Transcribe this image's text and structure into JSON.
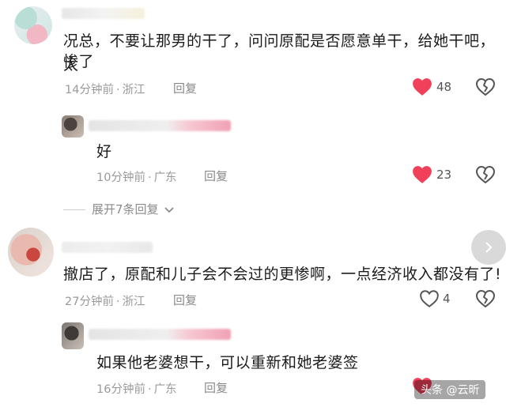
{
  "comments": [
    {
      "text_line1": "况总，不要让那男的干了，问问原配是否愿意单干，给她干吧，太",
      "text_line2": "惨了",
      "time": "14分钟前",
      "location": "浙江",
      "reply_label": "回复",
      "likes": "48",
      "liked": true
    },
    {
      "text_line1": "好",
      "time": "10分钟前",
      "location": "广东",
      "reply_label": "回复",
      "likes": "23",
      "liked": true
    },
    {
      "text_line1": "撤店了，原配和儿子会不会过的更惨啊，一点经济收入都没有了!",
      "time": "27分钟前",
      "location": "浙江",
      "reply_label": "回复",
      "likes": "4",
      "liked": false
    },
    {
      "text_line1": "如果他老婆想干，可以重新和她老婆签",
      "time": "16分钟前",
      "location": "广东",
      "reply_label": "回复",
      "liked": true
    }
  ],
  "expand_replies_label": "展开7条回复",
  "separator": "·",
  "watermark": "头条 @云昕",
  "colors": {
    "like_red": "#f0405a",
    "meta_gray": "#9a9a9a"
  }
}
